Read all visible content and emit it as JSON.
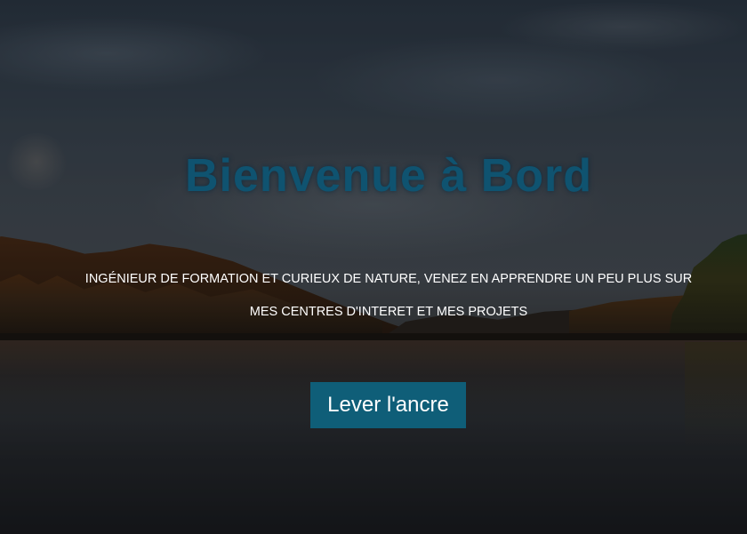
{
  "hero": {
    "title": "Bienvenue à Bord",
    "subtitle_line1": "INGÉNIEUR DE FORMATION ET CURIEUX DE NATURE, VENEZ EN APPRENDRE UN PEU PLUS SUR",
    "subtitle_line2": "MES CENTRES D'INTERET ET MES PROJETS",
    "cta_label": "Lever l'ancre"
  },
  "colors": {
    "title": "#0f5370",
    "button_bg": "#0f5e78",
    "button_text": "#ffffff",
    "subtitle_text": "#ffffff"
  }
}
